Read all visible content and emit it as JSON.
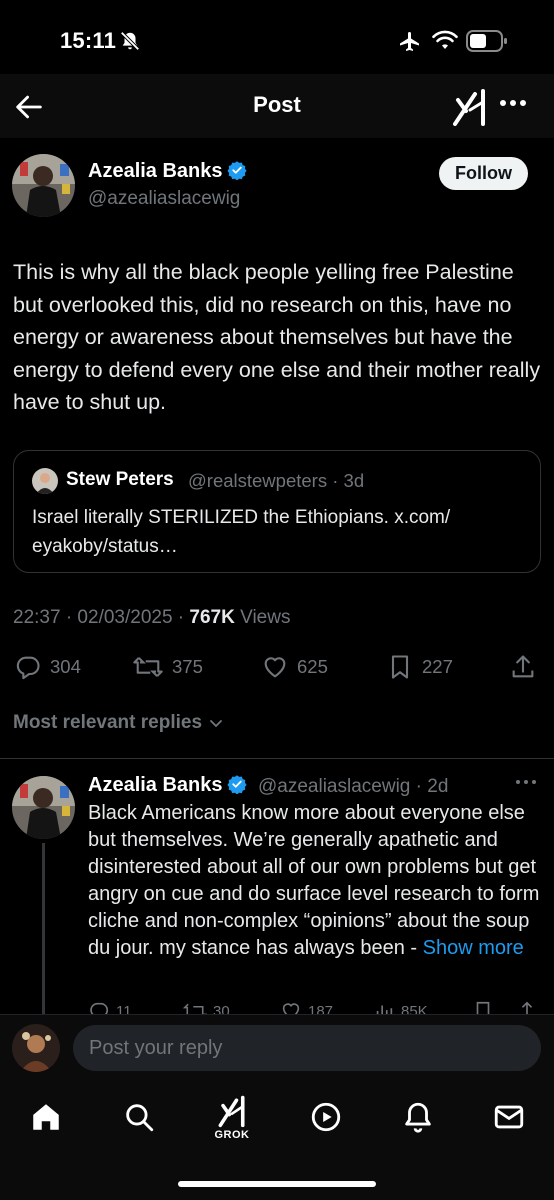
{
  "status_bar": {
    "time": "15:11"
  },
  "header": {
    "title": "Post"
  },
  "post": {
    "author_name": "Azealia Banks",
    "author_handle": "@azealiaslacewig",
    "follow_label": "Follow",
    "text": "This is why all the black people yelling free Palestine but overlooked this, did no research on this, have no energy or awareness about themselves but have the energy to defend every one else and their mother really have to shut up.",
    "quote": {
      "author_name": "Stew Peters",
      "meta": "@realstewpeters · 3d",
      "text": "Israel literally STERILIZED the Ethiopians. x.com/ eyakoby/status…"
    },
    "timestamp": "22:37 · 02/03/2025 ·",
    "views_count": "767K",
    "views_label": "Views",
    "stats": {
      "replies": "304",
      "reposts": "375",
      "likes": "625",
      "bookmarks": "227"
    }
  },
  "replies_sort_label": "Most relevant replies",
  "reply": {
    "author_name": "Azealia Banks",
    "meta": "@azealiaslacewig · 2d",
    "text": "Black Americans know more about everyone else but themselves. We’re generally apathetic and disinterested about all of our own problems but get angry on cue and do surface level research to form cliche and non-complex “opinions” about the soup du jour. my stance has always been - ",
    "show_more": "Show more",
    "stats": {
      "replies": "11",
      "reposts": "30",
      "likes": "187",
      "views": "85K"
    }
  },
  "composer": {
    "placeholder": "Post your reply"
  },
  "tabbar": {
    "grok_label": "GROK"
  },
  "colors": {
    "accent": "#1d9bf0",
    "muted": "#71767b",
    "text": "#e7e9ea",
    "background": "#000000"
  }
}
